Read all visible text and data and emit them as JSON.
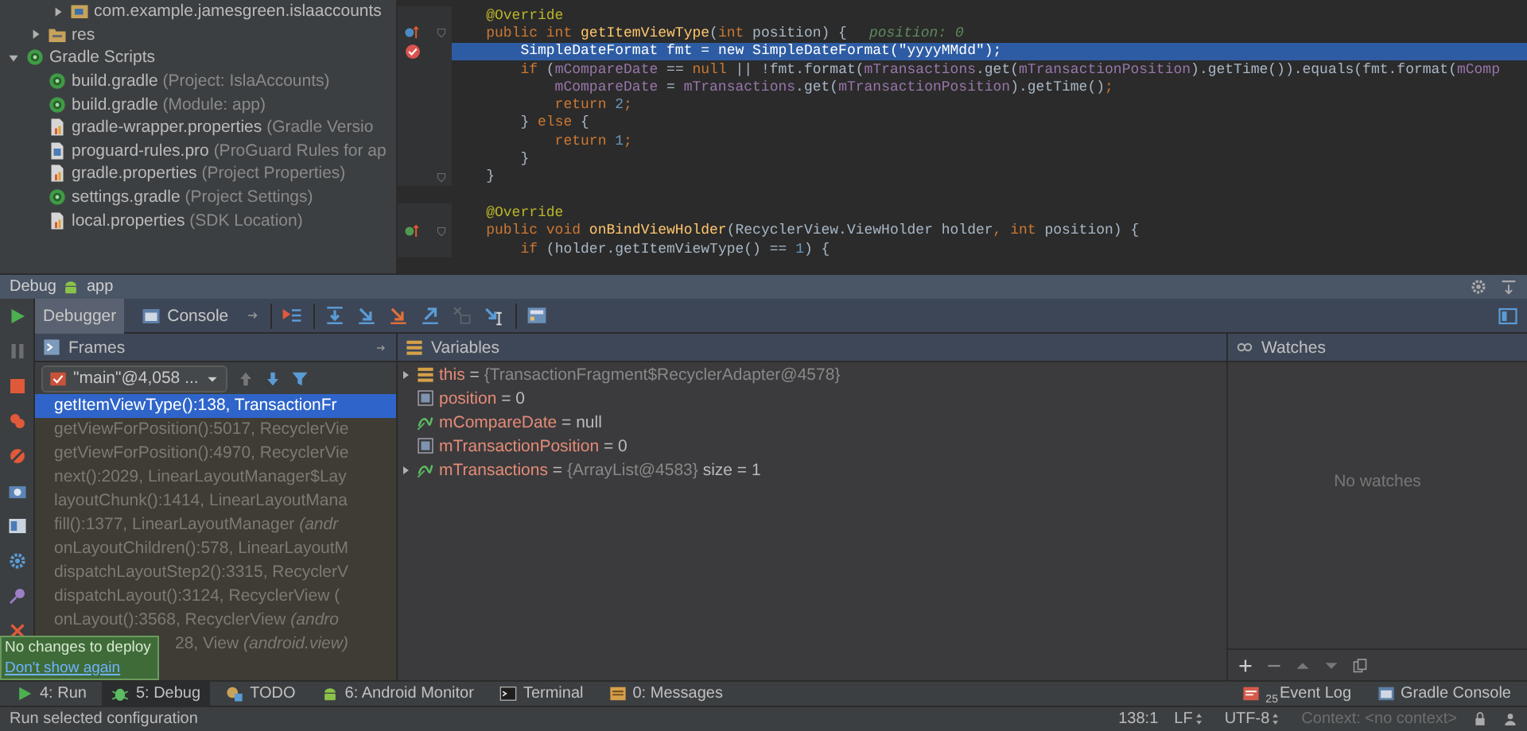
{
  "project_tree": [
    {
      "children": [
        {
          "children": [
            {
              "label": "com.example.jamesgreen.islaaccounts",
              "kind": "package",
              "expanded": false
            }
          ]
        },
        {
          "label": "res",
          "kind": "res_folder",
          "expanded": false
        }
      ]
    },
    {
      "label": "Gradle Scripts",
      "kind": "gradle",
      "expanded": true,
      "children": [
        {
          "label": "build.gradle",
          "hint": "(Project: IslaAccounts)",
          "kind": "gradle"
        },
        {
          "label": "build.gradle",
          "hint": "(Module: app)",
          "kind": "gradle"
        },
        {
          "label": "gradle-wrapper.properties",
          "hint": "(Gradle Versio",
          "kind": "properties"
        },
        {
          "label": "proguard-rules.pro",
          "hint": "(ProGuard Rules for ap",
          "kind": "text_file"
        },
        {
          "label": "gradle.properties",
          "hint": "(Project Properties)",
          "kind": "properties"
        },
        {
          "label": "settings.gradle",
          "hint": "(Project Settings)",
          "kind": "gradle"
        },
        {
          "label": "local.properties",
          "hint": "(SDK Location)",
          "kind": "properties"
        }
      ]
    }
  ],
  "editor": {
    "lines": [
      {
        "selected": false,
        "fold": false,
        "tokens": [
          {
            "t": "    @Override",
            "kind": "ann"
          }
        ]
      },
      {
        "selected": false,
        "fold": true,
        "marker": {
          "kind": "override"
        },
        "tokens": [
          {
            "t": "    public int ",
            "kind": "kw"
          },
          {
            "t": "getItemViewType",
            "kind": "fn"
          },
          {
            "t": "("
          },
          {
            "t": "int ",
            "kind": "kw"
          },
          {
            "t": "position) {"
          }
        ],
        "hint": "position: 0"
      },
      {
        "selected": true,
        "fold": false,
        "marker": {
          "kind": "breakpoint"
        },
        "tokens": [
          {
            "t": "        SimpleDateFormat fmt = "
          },
          {
            "t": "new ",
            "kind": "kw"
          },
          {
            "t": "SimpleDateFormat("
          },
          {
            "t": "\"yyyyMMdd\"",
            "kind": "str"
          },
          {
            "t": ");"
          }
        ]
      },
      {
        "selected": false,
        "fold": false,
        "tokens": [
          {
            "t": "        if ",
            "kind": "kw"
          },
          {
            "t": "("
          },
          {
            "t": "mCompareDate",
            "kind": "field"
          },
          {
            "t": " == "
          },
          {
            "t": "null ",
            "kind": "kw"
          },
          {
            "t": "|| !fmt.format("
          },
          {
            "t": "mTransactions",
            "kind": "field"
          },
          {
            "t": ".get("
          },
          {
            "t": "mTransactionPosition",
            "kind": "field"
          },
          {
            "t": ").getTime()).equals(fmt.format("
          },
          {
            "t": "mComp",
            "kind": "field"
          }
        ]
      },
      {
        "selected": false,
        "fold": false,
        "tokens": [
          {
            "t": "            mCompareDate",
            "kind": "field"
          },
          {
            "t": " = "
          },
          {
            "t": "mTransactions",
            "kind": "field"
          },
          {
            "t": ".get("
          },
          {
            "t": "mTransactionPosition",
            "kind": "field"
          },
          {
            "t": ").getTime()"
          },
          {
            "t": ";",
            "kind": "kw"
          }
        ]
      },
      {
        "selected": false,
        "fold": false,
        "tokens": [
          {
            "t": "            return ",
            "kind": "kw"
          },
          {
            "t": "2",
            "kind": "num"
          },
          {
            "t": ";",
            "kind": "kw"
          }
        ]
      },
      {
        "selected": false,
        "fold": false,
        "tokens": [
          {
            "t": "        } "
          },
          {
            "t": "else ",
            "kind": "kw"
          },
          {
            "t": "{"
          }
        ]
      },
      {
        "selected": false,
        "fold": false,
        "tokens": [
          {
            "t": "            return ",
            "kind": "kw"
          },
          {
            "t": "1",
            "kind": "num"
          },
          {
            "t": ";",
            "kind": "kw"
          }
        ]
      },
      {
        "selected": false,
        "fold": false,
        "tokens": [
          {
            "t": "        }"
          }
        ]
      },
      {
        "selected": false,
        "fold": true,
        "tokens": [
          {
            "t": "    }"
          }
        ]
      },
      {
        "selected": false,
        "fold": false,
        "spaced": true,
        "tokens": [
          {
            "t": "    @Override",
            "kind": "ann"
          }
        ]
      },
      {
        "selected": false,
        "fold": true,
        "marker": {
          "kind": "implement"
        },
        "tokens": [
          {
            "t": "    public void ",
            "kind": "kw"
          },
          {
            "t": "onBindViewHolder",
            "kind": "fn"
          },
          {
            "t": "(RecyclerView.ViewHolder holder"
          },
          {
            "t": ", int ",
            "kind": "kw"
          },
          {
            "t": "position) {"
          }
        ]
      },
      {
        "selected": false,
        "fold": false,
        "tokens": [
          {
            "t": "        if ",
            "kind": "kw"
          },
          {
            "t": "(holder.getItemViewType() == "
          },
          {
            "t": "1",
            "kind": "num"
          },
          {
            "t": ") {"
          }
        ]
      }
    ]
  },
  "debug": {
    "title": "Debug",
    "config": "app",
    "tabs": [
      {
        "label": "Debugger",
        "selected": true
      },
      {
        "label": "Console",
        "selected": false
      }
    ],
    "side_tools": [
      {
        "kind": "resume",
        "disabled": false
      },
      {
        "kind": "pause",
        "disabled": true
      },
      {
        "kind": "stop",
        "disabled": false
      },
      {
        "kind": "breakpoints",
        "disabled": false
      },
      {
        "kind": "mute",
        "disabled": false
      },
      {
        "kind": "dump",
        "disabled": false
      },
      {
        "kind": "layout",
        "disabled": false
      },
      {
        "kind": "settings",
        "disabled": false
      },
      {
        "kind": "pin",
        "disabled": false
      },
      {
        "kind": "close",
        "disabled": false
      }
    ],
    "steps": [
      {
        "kind": "show_point",
        "disabled": false
      },
      {
        "kind": "step_over",
        "disabled": false
      },
      {
        "kind": "step_into",
        "disabled": false
      },
      {
        "kind": "force_step_into",
        "disabled": false
      },
      {
        "kind": "step_out",
        "disabled": false
      },
      {
        "kind": "drop_frame",
        "disabled": true
      },
      {
        "kind": "run_to_cursor",
        "disabled": false
      },
      {
        "kind": "evaluate",
        "disabled": false
      }
    ],
    "frames": {
      "title": "Frames",
      "thread": "\"main\"@4,058 ...",
      "items": [
        {
          "text": "getItemViewType():138, TransactionFr",
          "selected": true,
          "library": false
        },
        {
          "text": "getViewForPosition():5017, RecyclerVie",
          "selected": false,
          "library": true
        },
        {
          "text": "getViewForPosition():4970, RecyclerVie",
          "selected": false,
          "library": true
        },
        {
          "text": "next():2029, LinearLayoutManager$Lay",
          "selected": false,
          "library": true
        },
        {
          "text": "layoutChunk():1414, LinearLayoutMana",
          "selected": false,
          "library": true
        },
        {
          "text": "fill():1377, LinearLayoutManager *(andr*",
          "selected": false,
          "library": true
        },
        {
          "text": "onLayoutChildren():578, LinearLayoutM",
          "selected": false,
          "library": true
        },
        {
          "text": "dispatchLayoutStep2():3315, RecyclerV",
          "selected": false,
          "library": true
        },
        {
          "text": "dispatchLayout():3124, RecyclerView (",
          "selected": false,
          "library": true
        },
        {
          "text": "onLayout():3568, RecyclerView *(andro*",
          "selected": false,
          "library": true
        },
        {
          "text": "28, View *(android.view)*",
          "selected": false,
          "library": true
        }
      ]
    },
    "variables": {
      "title": "Variables",
      "items": [
        {
          "expandable": true,
          "kind": "object",
          "name": "this",
          "op": "=",
          "value": "{TransactionFragment$RecyclerAdapter@4578}",
          "reference": true
        },
        {
          "expandable": false,
          "kind": "primitive",
          "name": "position",
          "op": "=",
          "value": "0",
          "reference": false
        },
        {
          "expandable": false,
          "kind": "field",
          "name": "mCompareDate",
          "op": "=",
          "value": "null",
          "reference": false
        },
        {
          "expandable": false,
          "kind": "primitive",
          "name": "mTransactionPosition",
          "op": "=",
          "value": "0",
          "reference": false
        },
        {
          "expandable": true,
          "kind": "field",
          "name": "mTransactions",
          "op": "=",
          "value": "{ArrayList@4583}",
          "reference": true,
          "extra": "size = 1"
        }
      ]
    },
    "watches": {
      "title": "Watches",
      "empty_text": "No watches"
    }
  },
  "deploy_tooltip": {
    "message": "No changes to deploy",
    "link": "Don't show again"
  },
  "tool_tabs": [
    {
      "label": "4: Run",
      "kind": "run",
      "selected": false
    },
    {
      "label": "5: Debug",
      "kind": "debug",
      "selected": true
    },
    {
      "label": "TODO",
      "kind": "todo",
      "selected": false
    },
    {
      "label": "6: Android Monitor",
      "kind": "android",
      "selected": false
    },
    {
      "label": "Terminal",
      "kind": "terminal",
      "selected": false
    },
    {
      "label": "0: Messages",
      "kind": "messages",
      "selected": false
    }
  ],
  "tool_tabs_right": [
    {
      "label": "Event Log",
      "badge": "25",
      "kind": "event"
    },
    {
      "label": "Gradle Console",
      "kind": "console"
    }
  ],
  "status_bar": {
    "message": "Run selected configuration",
    "position": "138:1",
    "line_ending": "LF",
    "encoding": "UTF-8",
    "context": "Context: <no context>"
  }
}
